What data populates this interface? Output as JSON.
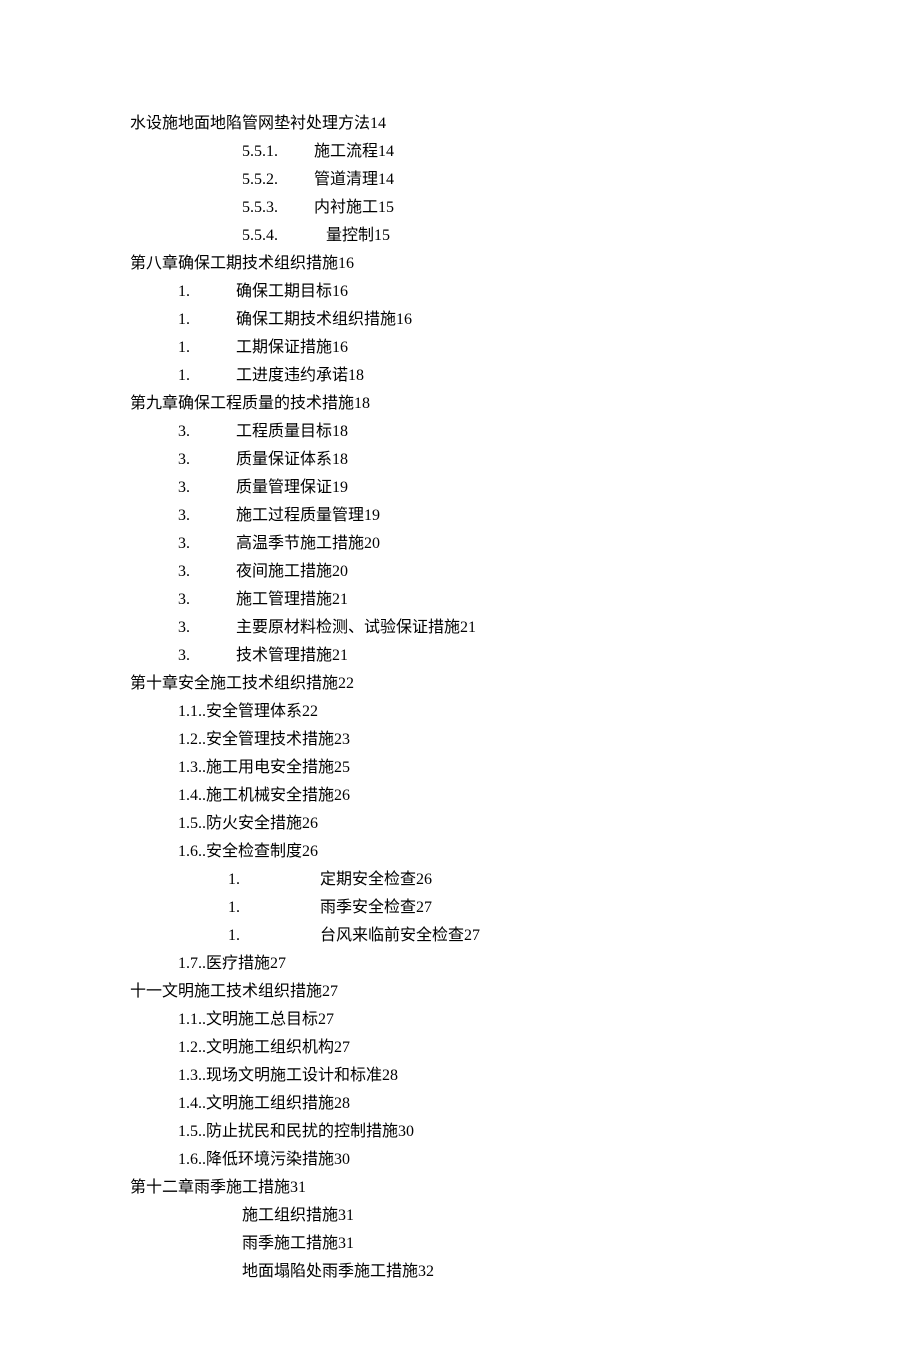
{
  "lines": {
    "l0": "水设施地面地陷管网垫衬处理方法14",
    "l1n": "5.5.1.",
    "l1t": "施工流程14",
    "l2n": "5.5.2.",
    "l2t": "管道清理14",
    "l3n": "5.5.3.",
    "l3t": "内衬施工15",
    "l4n": "5.5.4.",
    "l4t": "   量控制15",
    "c8": "第八章确保工期技术组织措施16",
    "c8_1n": "1.",
    "c8_1t": "确保工期目标16",
    "c8_2n": "1.",
    "c8_2t": "确保工期技术组织措施16",
    "c8_3n": "1.",
    "c8_3t": "工期保证措施16",
    "c8_4n": "1.",
    "c8_4t": "工进度违约承诺18",
    "c9": "第九章确保工程质量的技术措施18",
    "c9_1n": "3.",
    "c9_1t": "工程质量目标18",
    "c9_2n": "3.",
    "c9_2t": "质量保证体系18",
    "c9_3n": "3.",
    "c9_3t": "质量管理保证19",
    "c9_4n": "3.",
    "c9_4t": "施工过程质量管理19",
    "c9_5n": "3.",
    "c9_5t": "高温季节施工措施20",
    "c9_6n": "3.",
    "c9_6t": "夜间施工措施20",
    "c9_7n": "3.",
    "c9_7t": "施工管理措施21",
    "c9_8n": "3.",
    "c9_8t": "主要原材料检测、试验保证措施21",
    "c9_9n": "3.",
    "c9_9t": "技术管理措施21",
    "c10": "第十章安全施工技术组织措施22",
    "c10_1": "1.1..安全管理体系22",
    "c10_2": "1.2..安全管理技术措施23",
    "c10_3": "1.3..施工用电安全措施25",
    "c10_4": "1.4..施工机械安全措施26",
    "c10_5": "1.5..防火安全措施26",
    "c10_6": "1.6..安全检查制度26",
    "c10_6_1n": "1.",
    "c10_6_1t": "定期安全检查26",
    "c10_6_2n": "1.",
    "c10_6_2t": "雨季安全检查27",
    "c10_6_3n": "1.",
    "c10_6_3t": "台风来临前安全检查27",
    "c10_7": "1.7..医疗措施27",
    "c11": "十一文明施工技术组织措施27",
    "c11_1": "1.1..文明施工总目标27",
    "c11_2": "1.2..文明施工组织机构27",
    "c11_3": "1.3..现场文明施工设计和标准28",
    "c11_4": "1.4..文明施工组织措施28",
    "c11_5": "1.5..防止扰民和民扰的控制措施30",
    "c11_6": "1.6..降低环境污染措施30",
    "c12": "第十二章雨季施工措施31",
    "c12_1": "施工组织措施31",
    "c12_2": "雨季施工措施31",
    "c12_3": "地面塌陷处雨季施工措施32"
  }
}
